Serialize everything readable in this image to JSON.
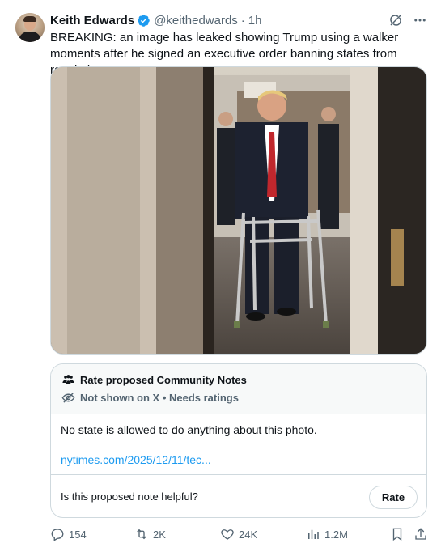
{
  "author": {
    "name": "Keith Edwards",
    "handle": "@keithedwards",
    "separator": "·",
    "time": "1h"
  },
  "tweet": {
    "text": "BREAKING: an image has leaked showing Trump using a walker moments after he signed an executive order banning states from regulating AI"
  },
  "community_note": {
    "title": "Rate proposed Community Notes",
    "status": "Not shown on X • Needs ratings",
    "body": "No state is allowed to do anything about this photo.",
    "link": "nytimes.com/2025/12/11/tec...",
    "question": "Is this proposed note helpful?",
    "rate_label": "Rate"
  },
  "metrics": {
    "replies": "154",
    "reposts": "2K",
    "likes": "24K",
    "views": "1.2M"
  },
  "icons": {
    "verified": "verified-badge-icon",
    "grok": "grok-icon",
    "more": "more-icon",
    "community": "people-icon",
    "hidden": "eye-off-icon",
    "reply": "reply-icon",
    "repost": "repost-icon",
    "like": "heart-icon",
    "views": "views-icon",
    "bookmark": "bookmark-icon",
    "share": "share-icon"
  },
  "colors": {
    "accent": "#1d9bf0",
    "text": "#0f1419",
    "muted": "#536471",
    "border": "#cfd9de"
  }
}
